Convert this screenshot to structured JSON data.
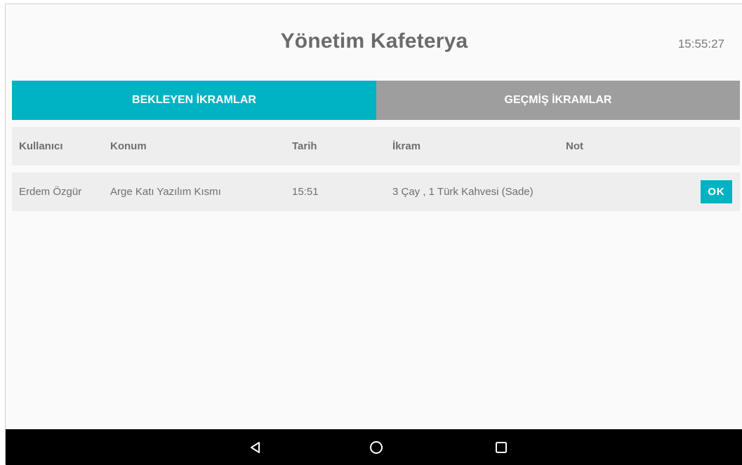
{
  "app": {
    "title": "Yönetim Kafeterya",
    "clock": "15:55:27"
  },
  "tabs": [
    {
      "label": "BEKLEYEN İKRAMLAR",
      "active": true
    },
    {
      "label": "GEÇMİŞ İKRAMLAR",
      "active": false
    }
  ],
  "table": {
    "headers": {
      "user": "Kullanıcı",
      "location": "Konum",
      "date": "Tarih",
      "item": "İkram",
      "note": "Not"
    },
    "rows": [
      {
        "user": "Erdem Özgür",
        "location": "Arge Katı Yazılım Kısmı",
        "date": "15:51",
        "item": "3 Çay , 1 Türk Kahvesi (Sade)",
        "note": "",
        "action": "OK"
      }
    ]
  },
  "navbar": {
    "icons": [
      "back-icon",
      "home-icon",
      "recent-apps-icon"
    ]
  },
  "colors": {
    "accent": "#00b3c4",
    "inactive_tab": "#9e9e9e",
    "row_background": "#eeeeee",
    "text": "#6f6f6f",
    "navbar": "#000000"
  }
}
